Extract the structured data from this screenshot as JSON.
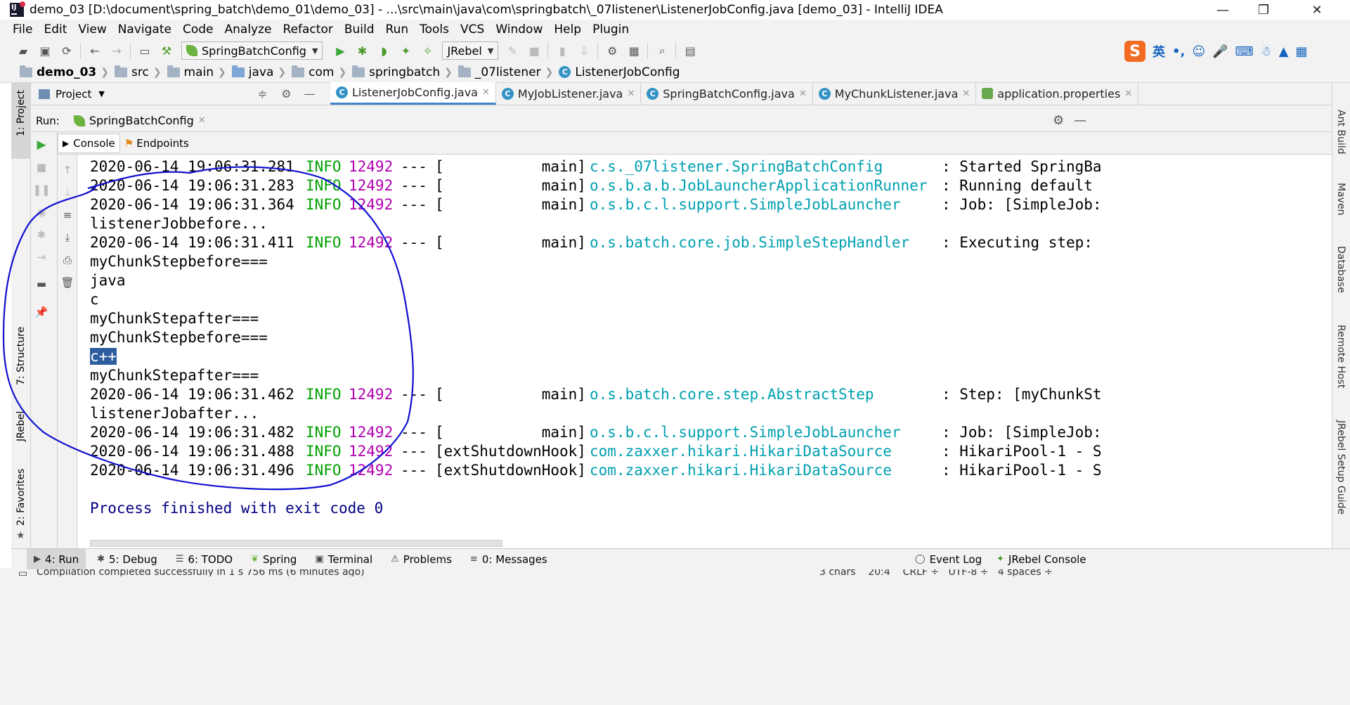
{
  "window": {
    "title": "demo_03 [D:\\document\\spring_batch\\demo_01\\demo_03] - ...\\src\\main\\java\\com\\springbatch\\_07listener\\ListenerJobConfig.java [demo_03] - IntelliJ IDEA",
    "minimize": "—",
    "restore": "❐",
    "close": "✕"
  },
  "menu": [
    "File",
    "Edit",
    "View",
    "Navigate",
    "Code",
    "Analyze",
    "Refactor",
    "Build",
    "Run",
    "Tools",
    "VCS",
    "Window",
    "Help",
    "Plugin"
  ],
  "toolbar": {
    "run_config": "SpringBatchConfig",
    "jrebel": "JRebel"
  },
  "ime": {
    "logo": "S",
    "lang": "英"
  },
  "breadcrumb": [
    "demo_03",
    "src",
    "main",
    "java",
    "com",
    "springbatch",
    "_07listener",
    "ListenerJobConfig"
  ],
  "left_tools": {
    "project": "1: Project",
    "structure": "7: Structure",
    "jrebel": "JRebel",
    "favorites": "2: Favorites"
  },
  "right_tools": [
    "Ant Build",
    "Maven",
    "Database",
    "Remote Host",
    "JRebel Setup Guide"
  ],
  "project_panel": {
    "label": "Project"
  },
  "editor_tabs": [
    "ListenerJobConfig.java",
    "MyJobListener.java",
    "SpringBatchConfig.java",
    "MyChunkListener.java",
    "application.properties"
  ],
  "run_panel": {
    "label": "Run:",
    "config_tab": "SpringBatchConfig",
    "console_tab": "Console",
    "endpoints_tab": "Endpoints"
  },
  "console_lines": [
    {
      "type": "log",
      "time": "2020-06-14 19:06:31.281",
      "level": "INFO",
      "pid": "12492",
      "sep": "---",
      "thread": "[           main]",
      "logger": "c.s._07listener.SpringBatchConfig",
      "msg": ": Started SpringBa"
    },
    {
      "type": "log",
      "time": "2020-06-14 19:06:31.283",
      "level": "INFO",
      "pid": "12492",
      "sep": "---",
      "thread": "[           main]",
      "logger": "o.s.b.a.b.JobLauncherApplicationRunner",
      "msg": ": Running default"
    },
    {
      "type": "log",
      "time": "2020-06-14 19:06:31.364",
      "level": "INFO",
      "pid": "12492",
      "sep": "---",
      "thread": "[           main]",
      "logger": "o.s.b.c.l.support.SimpleJobLauncher",
      "msg": ": Job: [SimpleJob:"
    },
    {
      "type": "text",
      "text": "listenerJobbefore..."
    },
    {
      "type": "log",
      "time": "2020-06-14 19:06:31.411",
      "level": "INFO",
      "pid": "12492",
      "sep": "---",
      "thread": "[           main]",
      "logger": "o.s.batch.core.job.SimpleStepHandler",
      "msg": ": Executing step:"
    },
    {
      "type": "text",
      "text": "myChunkStepbefore==="
    },
    {
      "type": "text",
      "text": "java"
    },
    {
      "type": "text",
      "text": "c"
    },
    {
      "type": "text",
      "text": "myChunkStepafter==="
    },
    {
      "type": "text",
      "text": "myChunkStepbefore==="
    },
    {
      "type": "selected",
      "text": "c++"
    },
    {
      "type": "text",
      "text": "myChunkStepafter==="
    },
    {
      "type": "log",
      "time": "2020-06-14 19:06:31.462",
      "level": "INFO",
      "pid": "12492",
      "sep": "---",
      "thread": "[           main]",
      "logger": "o.s.batch.core.step.AbstractStep",
      "msg": ": Step: [myChunkSt"
    },
    {
      "type": "text",
      "text": "listenerJobafter..."
    },
    {
      "type": "log",
      "time": "2020-06-14 19:06:31.482",
      "level": "INFO",
      "pid": "12492",
      "sep": "---",
      "thread": "[           main]",
      "logger": "o.s.b.c.l.support.SimpleJobLauncher",
      "msg": ": Job: [SimpleJob:"
    },
    {
      "type": "log",
      "time": "2020-06-14 19:06:31.488",
      "level": "INFO",
      "pid": "12492",
      "sep": "---",
      "thread": "[extShutdownHook]",
      "logger": "com.zaxxer.hikari.HikariDataSource",
      "msg": ": HikariPool-1 - S"
    },
    {
      "type": "log",
      "time": "2020-06-14 19:06:31.496",
      "level": "INFO",
      "pid": "12492",
      "sep": "---",
      "thread": "[extShutdownHook]",
      "logger": "com.zaxxer.hikari.HikariDataSource",
      "msg": ": HikariPool-1 - S"
    },
    {
      "type": "blank",
      "text": ""
    },
    {
      "type": "finish",
      "text": "Process finished with exit code 0"
    }
  ],
  "bottom_tabs": [
    {
      "label": "4: Run",
      "icon": "play-icon"
    },
    {
      "label": "5: Debug",
      "icon": "bug-icon"
    },
    {
      "label": "6: TODO",
      "icon": "list-icon"
    },
    {
      "label": "Spring",
      "icon": "spring-leaf-icon"
    },
    {
      "label": "Terminal",
      "icon": "terminal-icon"
    },
    {
      "label": "Problems",
      "icon": "warning-icon"
    },
    {
      "label": "0: Messages",
      "icon": "messages-icon"
    }
  ],
  "bottom_right_tabs": [
    {
      "label": "Event Log",
      "icon": "event-log-icon"
    },
    {
      "label": "JRebel Console",
      "icon": "jrebel-icon"
    }
  ],
  "status": {
    "message": "Compilation completed successfully in 1 s 756 ms (6 minutes ago)",
    "right": "3 chars    20:4    CRLF ÷   UTF-8 ÷   4 spaces ÷"
  },
  "colors": {
    "info": "#00a000",
    "pid": "#b000b0",
    "logger": "#00a0b0",
    "finish": "#000080",
    "annotation": "#1010d0",
    "selection": "#2e5d9e"
  }
}
